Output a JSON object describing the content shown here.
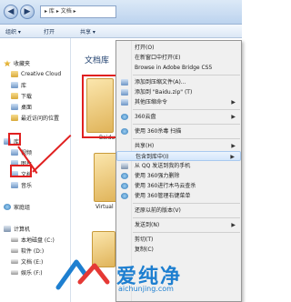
{
  "address": {
    "path": "▸ 库 ▸ 文档 ▸"
  },
  "toolbar": {
    "organize": "组织 ▾",
    "open": "打开",
    "share": "共享 ▾"
  },
  "nav": {
    "favorites": "收藏夹",
    "items": [
      "Creative Cloud",
      "库",
      "下载",
      "桌面",
      "最近访问的位置"
    ],
    "libraries": "库",
    "library_items": [
      "视频",
      "图片",
      "文档",
      "音乐"
    ],
    "homegroup": "家庭组",
    "computer": "计算机",
    "drives": [
      "本地磁盘 (C:)",
      "软件 (D:)",
      "文档 (E:)",
      "娱乐 (F:)"
    ]
  },
  "content": {
    "title": "文档库",
    "thumb_labels": [
      "Baidu",
      "Virtual Machin"
    ]
  },
  "menu": {
    "items": [
      {
        "label": "打开(O)",
        "arrow": false
      },
      {
        "label": "在新窗口中打开(E)",
        "arrow": false
      },
      {
        "label": "Browse in Adobe Bridge CS5",
        "arrow": false
      },
      {
        "label": "添加到压缩文件(A)...",
        "arrow": false
      },
      {
        "label": "添加到 \"Baidu.zip\" (T)",
        "arrow": false
      },
      {
        "label": "其他压缩命令",
        "arrow": true
      },
      {
        "label": "360云盘",
        "arrow": true
      },
      {
        "label": "使用 360杀毒 扫描",
        "arrow": false
      },
      {
        "label": "共享(H)",
        "arrow": true
      },
      {
        "label": "包含到库中(I)",
        "arrow": true
      },
      {
        "label": "从 QQ 发送到我的手机",
        "arrow": false
      },
      {
        "label": "使用 360强力删除",
        "arrow": false
      },
      {
        "label": "使用 360进行木马云查杀",
        "arrow": false
      },
      {
        "label": "使用 360管理右键菜单",
        "arrow": false
      },
      {
        "label": "还原以前的版本(V)",
        "arrow": false
      },
      {
        "label": "发送到(N)",
        "arrow": true
      },
      {
        "label": "剪切(T)",
        "arrow": false
      },
      {
        "label": "复制(C)",
        "arrow": false
      }
    ]
  },
  "watermark": {
    "brand": "爱纯净",
    "url": "aichunjing.com"
  },
  "colors": {
    "highlight": "#e02020",
    "brand": "#1e7fd0"
  }
}
